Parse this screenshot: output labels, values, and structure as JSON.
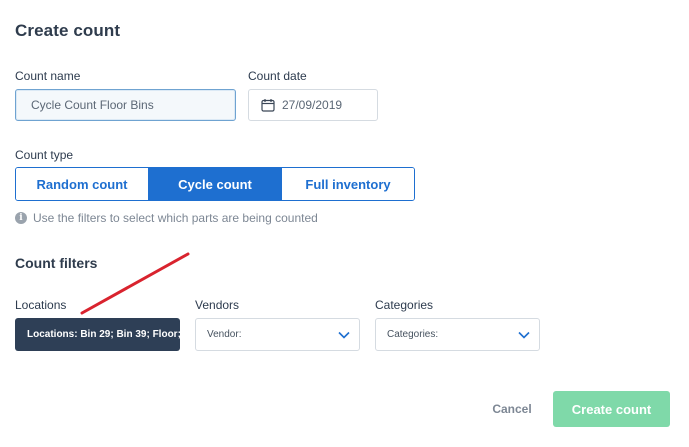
{
  "dialog": {
    "title": "Create count"
  },
  "form": {
    "count_name": {
      "label": "Count name",
      "value": "Cycle Count Floor Bins"
    },
    "count_date": {
      "label": "Count date",
      "value": "27/09/2019",
      "icon": "calendar-icon"
    },
    "count_type": {
      "label": "Count type",
      "options": [
        "Random count",
        "Cycle count",
        "Full inventory"
      ],
      "selected": "Cycle count"
    },
    "hint": "Use the filters to select which parts are being counted"
  },
  "filters": {
    "title": "Count filters",
    "locations": {
      "label": "Locations",
      "value": "Locations: Bin 29; Bin 39; Floor;"
    },
    "vendors": {
      "label": "Vendors",
      "value": "Vendor:",
      "icon": "chevron-down-icon"
    },
    "categories": {
      "label": "Categories",
      "value": "Categories:",
      "icon": "chevron-down-icon"
    }
  },
  "actions": {
    "cancel_label": "Cancel",
    "create_label": "Create count"
  },
  "colors": {
    "primary": "#1e6fd0",
    "create_button": "#7fd9a9",
    "locations_fill": "#2e3f56",
    "annotation_arrow": "#d9232e"
  }
}
